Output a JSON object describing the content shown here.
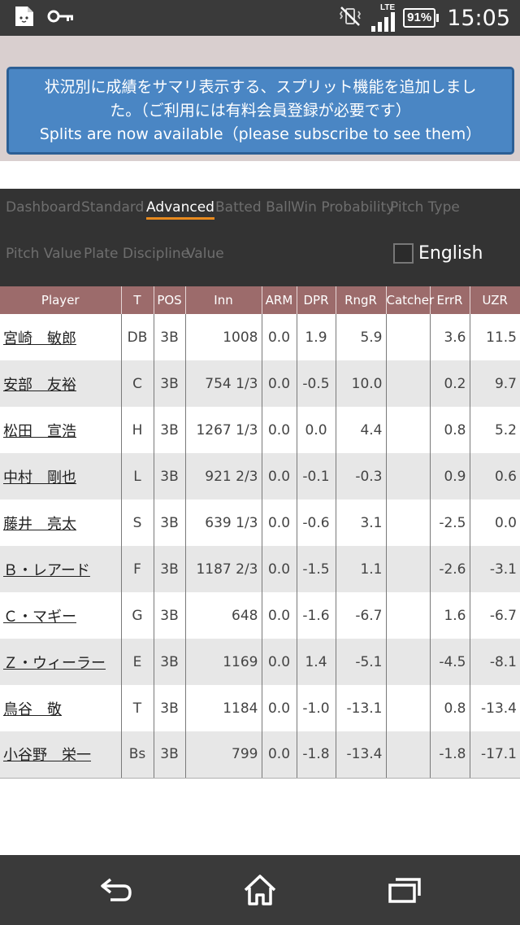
{
  "status": {
    "time": "15:05",
    "battery": "91%",
    "network": "LTE",
    "icons": [
      "cat-face-icon",
      "key-icon",
      "vibrate-off-icon",
      "signal-icon",
      "battery-icon"
    ]
  },
  "notice": {
    "line1": "状況別に成績をサマリ表示する、スプリット機能を追加しまし",
    "line2": "た。（ご利用には有料会員登録が必要です）",
    "line3": "Splits are now available（please subscribe to see them）"
  },
  "tabs": {
    "dashboard": "Dashboard",
    "standard": "Standard",
    "advanced": "Advanced",
    "batted_ball": "Batted Ball",
    "win_probability": "Win Probability",
    "pitch_type": "Pitch Type",
    "pitch_value": "Pitch Value",
    "plate_discipline": "Plate Discipline",
    "value": "Value",
    "english": "English"
  },
  "table": {
    "headers": {
      "player": "Player",
      "t": "T",
      "pos": "POS",
      "inn": "Inn",
      "arm": "ARM",
      "dpr": "DPR",
      "rngr": "RngR",
      "catcher": "Catcher",
      "errr": "ErrR",
      "uzr": "UZR"
    },
    "rows": [
      {
        "player": "宮崎　敏郎",
        "t": "DB",
        "pos": "3B",
        "inn": "1008",
        "arm": "0.0",
        "dpr": "1.9",
        "rngr": "5.9",
        "catcher": "",
        "errr": "3.6",
        "uzr": "11.5"
      },
      {
        "player": "安部　友裕",
        "t": "C",
        "pos": "3B",
        "inn": "754 1/3",
        "arm": "0.0",
        "dpr": "-0.5",
        "rngr": "10.0",
        "catcher": "",
        "errr": "0.2",
        "uzr": "9.7"
      },
      {
        "player": "松田　宣浩",
        "t": "H",
        "pos": "3B",
        "inn": "1267 1/3",
        "arm": "0.0",
        "dpr": "0.0",
        "rngr": "4.4",
        "catcher": "",
        "errr": "0.8",
        "uzr": "5.2"
      },
      {
        "player": "中村　剛也",
        "t": "L",
        "pos": "3B",
        "inn": "921 2/3",
        "arm": "0.0",
        "dpr": "-0.1",
        "rngr": "-0.3",
        "catcher": "",
        "errr": "0.9",
        "uzr": "0.6"
      },
      {
        "player": "藤井　亮太",
        "t": "S",
        "pos": "3B",
        "inn": "639 1/3",
        "arm": "0.0",
        "dpr": "-0.6",
        "rngr": "3.1",
        "catcher": "",
        "errr": "-2.5",
        "uzr": "0.0"
      },
      {
        "player": "Ｂ・レアード",
        "t": "F",
        "pos": "3B",
        "inn": "1187 2/3",
        "arm": "0.0",
        "dpr": "-1.5",
        "rngr": "1.1",
        "catcher": "",
        "errr": "-2.6",
        "uzr": "-3.1"
      },
      {
        "player": "Ｃ・マギー",
        "t": "G",
        "pos": "3B",
        "inn": "648",
        "arm": "0.0",
        "dpr": "-1.6",
        "rngr": "-6.7",
        "catcher": "",
        "errr": "1.6",
        "uzr": "-6.7"
      },
      {
        "player": "Ｚ・ウィーラー",
        "t": "E",
        "pos": "3B",
        "inn": "1169",
        "arm": "0.0",
        "dpr": "1.4",
        "rngr": "-5.1",
        "catcher": "",
        "errr": "-4.5",
        "uzr": "-8.1"
      },
      {
        "player": "鳥谷　敬",
        "t": "T",
        "pos": "3B",
        "inn": "1184",
        "arm": "0.0",
        "dpr": "-1.0",
        "rngr": "-13.1",
        "catcher": "",
        "errr": "0.8",
        "uzr": "-13.4"
      },
      {
        "player": "小谷野　栄一",
        "t": "Bs",
        "pos": "3B",
        "inn": "799",
        "arm": "0.0",
        "dpr": "-1.8",
        "rngr": "-13.4",
        "catcher": "",
        "errr": "-1.8",
        "uzr": "-17.1"
      }
    ]
  },
  "nav": {
    "back": "back-arrow-icon",
    "home": "home-icon",
    "recents": "recent-apps-icon"
  }
}
